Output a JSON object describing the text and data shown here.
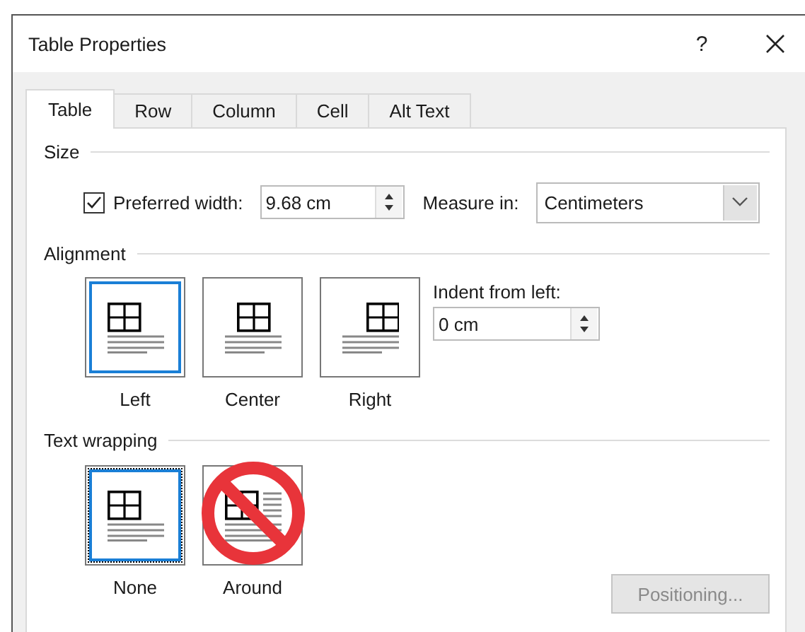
{
  "window": {
    "title": "Table Properties",
    "help": "?"
  },
  "tabs": [
    {
      "label": "Table",
      "selected": true
    },
    {
      "label": "Row",
      "selected": false
    },
    {
      "label": "Column",
      "selected": false
    },
    {
      "label": "Cell",
      "selected": false
    },
    {
      "label": "Alt Text",
      "selected": false
    }
  ],
  "size": {
    "heading": "Size",
    "preferred_width": {
      "label": "Preferred width:",
      "checked": true,
      "value": "9.68 cm"
    },
    "measure_in": {
      "label": "Measure in:",
      "value": "Centimeters"
    }
  },
  "alignment": {
    "heading": "Alignment",
    "options": [
      {
        "kind": "left",
        "label": "Left",
        "selected": true
      },
      {
        "kind": "center",
        "label": "Center",
        "selected": false
      },
      {
        "kind": "right",
        "label": "Right",
        "selected": false
      }
    ],
    "indent": {
      "label": "Indent from left:",
      "value": "0 cm"
    }
  },
  "text_wrapping": {
    "heading": "Text wrapping",
    "options": [
      {
        "kind": "none",
        "label": "None",
        "selected": true,
        "crossed_out": false
      },
      {
        "kind": "around",
        "label": "Around",
        "selected": false,
        "crossed_out": true
      }
    ]
  },
  "buttons": [
    {
      "label": "Positioning...",
      "disabled": true
    }
  ]
}
